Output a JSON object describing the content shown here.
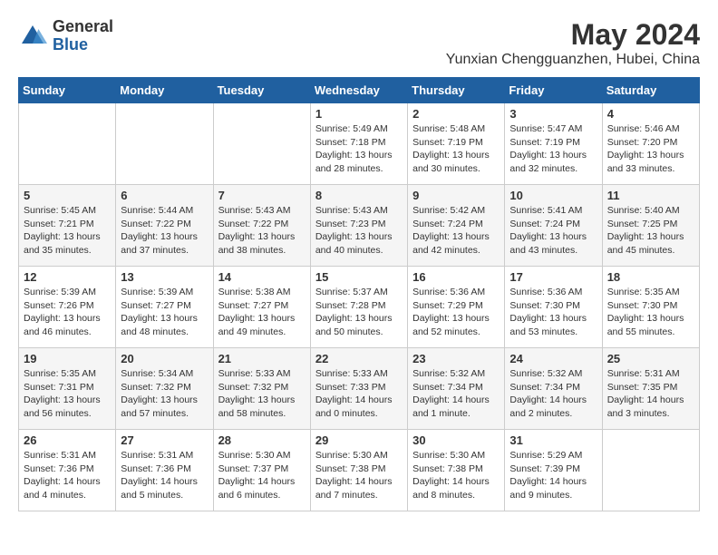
{
  "logo": {
    "general": "General",
    "blue": "Blue"
  },
  "title": "May 2024",
  "subtitle": "Yunxian Chengguanzhen, Hubei, China",
  "days_of_week": [
    "Sunday",
    "Monday",
    "Tuesday",
    "Wednesday",
    "Thursday",
    "Friday",
    "Saturday"
  ],
  "weeks": [
    [
      {
        "num": "",
        "info": ""
      },
      {
        "num": "",
        "info": ""
      },
      {
        "num": "",
        "info": ""
      },
      {
        "num": "1",
        "info": "Sunrise: 5:49 AM\nSunset: 7:18 PM\nDaylight: 13 hours\nand 28 minutes."
      },
      {
        "num": "2",
        "info": "Sunrise: 5:48 AM\nSunset: 7:19 PM\nDaylight: 13 hours\nand 30 minutes."
      },
      {
        "num": "3",
        "info": "Sunrise: 5:47 AM\nSunset: 7:19 PM\nDaylight: 13 hours\nand 32 minutes."
      },
      {
        "num": "4",
        "info": "Sunrise: 5:46 AM\nSunset: 7:20 PM\nDaylight: 13 hours\nand 33 minutes."
      }
    ],
    [
      {
        "num": "5",
        "info": "Sunrise: 5:45 AM\nSunset: 7:21 PM\nDaylight: 13 hours\nand 35 minutes."
      },
      {
        "num": "6",
        "info": "Sunrise: 5:44 AM\nSunset: 7:22 PM\nDaylight: 13 hours\nand 37 minutes."
      },
      {
        "num": "7",
        "info": "Sunrise: 5:43 AM\nSunset: 7:22 PM\nDaylight: 13 hours\nand 38 minutes."
      },
      {
        "num": "8",
        "info": "Sunrise: 5:43 AM\nSunset: 7:23 PM\nDaylight: 13 hours\nand 40 minutes."
      },
      {
        "num": "9",
        "info": "Sunrise: 5:42 AM\nSunset: 7:24 PM\nDaylight: 13 hours\nand 42 minutes."
      },
      {
        "num": "10",
        "info": "Sunrise: 5:41 AM\nSunset: 7:24 PM\nDaylight: 13 hours\nand 43 minutes."
      },
      {
        "num": "11",
        "info": "Sunrise: 5:40 AM\nSunset: 7:25 PM\nDaylight: 13 hours\nand 45 minutes."
      }
    ],
    [
      {
        "num": "12",
        "info": "Sunrise: 5:39 AM\nSunset: 7:26 PM\nDaylight: 13 hours\nand 46 minutes."
      },
      {
        "num": "13",
        "info": "Sunrise: 5:39 AM\nSunset: 7:27 PM\nDaylight: 13 hours\nand 48 minutes."
      },
      {
        "num": "14",
        "info": "Sunrise: 5:38 AM\nSunset: 7:27 PM\nDaylight: 13 hours\nand 49 minutes."
      },
      {
        "num": "15",
        "info": "Sunrise: 5:37 AM\nSunset: 7:28 PM\nDaylight: 13 hours\nand 50 minutes."
      },
      {
        "num": "16",
        "info": "Sunrise: 5:36 AM\nSunset: 7:29 PM\nDaylight: 13 hours\nand 52 minutes."
      },
      {
        "num": "17",
        "info": "Sunrise: 5:36 AM\nSunset: 7:30 PM\nDaylight: 13 hours\nand 53 minutes."
      },
      {
        "num": "18",
        "info": "Sunrise: 5:35 AM\nSunset: 7:30 PM\nDaylight: 13 hours\nand 55 minutes."
      }
    ],
    [
      {
        "num": "19",
        "info": "Sunrise: 5:35 AM\nSunset: 7:31 PM\nDaylight: 13 hours\nand 56 minutes."
      },
      {
        "num": "20",
        "info": "Sunrise: 5:34 AM\nSunset: 7:32 PM\nDaylight: 13 hours\nand 57 minutes."
      },
      {
        "num": "21",
        "info": "Sunrise: 5:33 AM\nSunset: 7:32 PM\nDaylight: 13 hours\nand 58 minutes."
      },
      {
        "num": "22",
        "info": "Sunrise: 5:33 AM\nSunset: 7:33 PM\nDaylight: 14 hours\nand 0 minutes."
      },
      {
        "num": "23",
        "info": "Sunrise: 5:32 AM\nSunset: 7:34 PM\nDaylight: 14 hours\nand 1 minute."
      },
      {
        "num": "24",
        "info": "Sunrise: 5:32 AM\nSunset: 7:34 PM\nDaylight: 14 hours\nand 2 minutes."
      },
      {
        "num": "25",
        "info": "Sunrise: 5:31 AM\nSunset: 7:35 PM\nDaylight: 14 hours\nand 3 minutes."
      }
    ],
    [
      {
        "num": "26",
        "info": "Sunrise: 5:31 AM\nSunset: 7:36 PM\nDaylight: 14 hours\nand 4 minutes."
      },
      {
        "num": "27",
        "info": "Sunrise: 5:31 AM\nSunset: 7:36 PM\nDaylight: 14 hours\nand 5 minutes."
      },
      {
        "num": "28",
        "info": "Sunrise: 5:30 AM\nSunset: 7:37 PM\nDaylight: 14 hours\nand 6 minutes."
      },
      {
        "num": "29",
        "info": "Sunrise: 5:30 AM\nSunset: 7:38 PM\nDaylight: 14 hours\nand 7 minutes."
      },
      {
        "num": "30",
        "info": "Sunrise: 5:30 AM\nSunset: 7:38 PM\nDaylight: 14 hours\nand 8 minutes."
      },
      {
        "num": "31",
        "info": "Sunrise: 5:29 AM\nSunset: 7:39 PM\nDaylight: 14 hours\nand 9 minutes."
      },
      {
        "num": "",
        "info": ""
      }
    ]
  ]
}
